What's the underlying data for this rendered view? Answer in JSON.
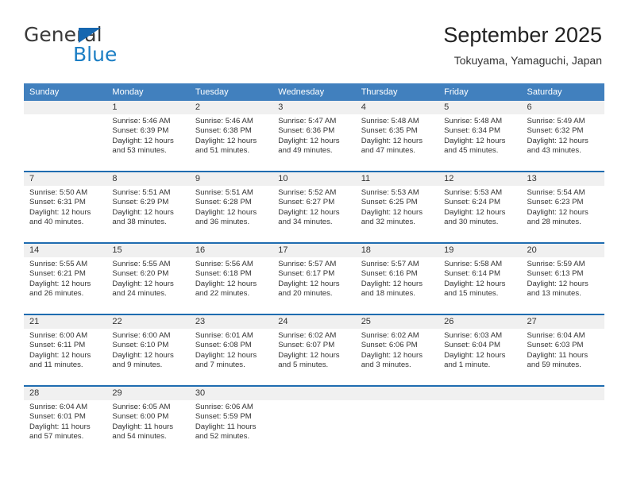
{
  "logo": {
    "word_top": "General",
    "word_bottom": "Blue",
    "triangle_color": "#1667b0",
    "blue_color": "#1b7ec4"
  },
  "header": {
    "title": "September 2025",
    "subtitle": "Tokuyama, Yamaguchi, Japan"
  },
  "theme": {
    "header_bar": "#4180be",
    "row_separator": "#1f6cb0",
    "day_band": "#f0f0f0"
  },
  "weekdays": [
    "Sunday",
    "Monday",
    "Tuesday",
    "Wednesday",
    "Thursday",
    "Friday",
    "Saturday"
  ],
  "weeks": [
    [
      {
        "day": "",
        "sunrise": "",
        "sunset": "",
        "daylight1": "",
        "daylight2": "",
        "empty": true
      },
      {
        "day": "1",
        "sunrise": "Sunrise: 5:46 AM",
        "sunset": "Sunset: 6:39 PM",
        "daylight1": "Daylight: 12 hours",
        "daylight2": "and 53 minutes."
      },
      {
        "day": "2",
        "sunrise": "Sunrise: 5:46 AM",
        "sunset": "Sunset: 6:38 PM",
        "daylight1": "Daylight: 12 hours",
        "daylight2": "and 51 minutes."
      },
      {
        "day": "3",
        "sunrise": "Sunrise: 5:47 AM",
        "sunset": "Sunset: 6:36 PM",
        "daylight1": "Daylight: 12 hours",
        "daylight2": "and 49 minutes."
      },
      {
        "day": "4",
        "sunrise": "Sunrise: 5:48 AM",
        "sunset": "Sunset: 6:35 PM",
        "daylight1": "Daylight: 12 hours",
        "daylight2": "and 47 minutes."
      },
      {
        "day": "5",
        "sunrise": "Sunrise: 5:48 AM",
        "sunset": "Sunset: 6:34 PM",
        "daylight1": "Daylight: 12 hours",
        "daylight2": "and 45 minutes."
      },
      {
        "day": "6",
        "sunrise": "Sunrise: 5:49 AM",
        "sunset": "Sunset: 6:32 PM",
        "daylight1": "Daylight: 12 hours",
        "daylight2": "and 43 minutes."
      }
    ],
    [
      {
        "day": "7",
        "sunrise": "Sunrise: 5:50 AM",
        "sunset": "Sunset: 6:31 PM",
        "daylight1": "Daylight: 12 hours",
        "daylight2": "and 40 minutes."
      },
      {
        "day": "8",
        "sunrise": "Sunrise: 5:51 AM",
        "sunset": "Sunset: 6:29 PM",
        "daylight1": "Daylight: 12 hours",
        "daylight2": "and 38 minutes."
      },
      {
        "day": "9",
        "sunrise": "Sunrise: 5:51 AM",
        "sunset": "Sunset: 6:28 PM",
        "daylight1": "Daylight: 12 hours",
        "daylight2": "and 36 minutes."
      },
      {
        "day": "10",
        "sunrise": "Sunrise: 5:52 AM",
        "sunset": "Sunset: 6:27 PM",
        "daylight1": "Daylight: 12 hours",
        "daylight2": "and 34 minutes."
      },
      {
        "day": "11",
        "sunrise": "Sunrise: 5:53 AM",
        "sunset": "Sunset: 6:25 PM",
        "daylight1": "Daylight: 12 hours",
        "daylight2": "and 32 minutes."
      },
      {
        "day": "12",
        "sunrise": "Sunrise: 5:53 AM",
        "sunset": "Sunset: 6:24 PM",
        "daylight1": "Daylight: 12 hours",
        "daylight2": "and 30 minutes."
      },
      {
        "day": "13",
        "sunrise": "Sunrise: 5:54 AM",
        "sunset": "Sunset: 6:23 PM",
        "daylight1": "Daylight: 12 hours",
        "daylight2": "and 28 minutes."
      }
    ],
    [
      {
        "day": "14",
        "sunrise": "Sunrise: 5:55 AM",
        "sunset": "Sunset: 6:21 PM",
        "daylight1": "Daylight: 12 hours",
        "daylight2": "and 26 minutes."
      },
      {
        "day": "15",
        "sunrise": "Sunrise: 5:55 AM",
        "sunset": "Sunset: 6:20 PM",
        "daylight1": "Daylight: 12 hours",
        "daylight2": "and 24 minutes."
      },
      {
        "day": "16",
        "sunrise": "Sunrise: 5:56 AM",
        "sunset": "Sunset: 6:18 PM",
        "daylight1": "Daylight: 12 hours",
        "daylight2": "and 22 minutes."
      },
      {
        "day": "17",
        "sunrise": "Sunrise: 5:57 AM",
        "sunset": "Sunset: 6:17 PM",
        "daylight1": "Daylight: 12 hours",
        "daylight2": "and 20 minutes."
      },
      {
        "day": "18",
        "sunrise": "Sunrise: 5:57 AM",
        "sunset": "Sunset: 6:16 PM",
        "daylight1": "Daylight: 12 hours",
        "daylight2": "and 18 minutes."
      },
      {
        "day": "19",
        "sunrise": "Sunrise: 5:58 AM",
        "sunset": "Sunset: 6:14 PM",
        "daylight1": "Daylight: 12 hours",
        "daylight2": "and 15 minutes."
      },
      {
        "day": "20",
        "sunrise": "Sunrise: 5:59 AM",
        "sunset": "Sunset: 6:13 PM",
        "daylight1": "Daylight: 12 hours",
        "daylight2": "and 13 minutes."
      }
    ],
    [
      {
        "day": "21",
        "sunrise": "Sunrise: 6:00 AM",
        "sunset": "Sunset: 6:11 PM",
        "daylight1": "Daylight: 12 hours",
        "daylight2": "and 11 minutes."
      },
      {
        "day": "22",
        "sunrise": "Sunrise: 6:00 AM",
        "sunset": "Sunset: 6:10 PM",
        "daylight1": "Daylight: 12 hours",
        "daylight2": "and 9 minutes."
      },
      {
        "day": "23",
        "sunrise": "Sunrise: 6:01 AM",
        "sunset": "Sunset: 6:08 PM",
        "daylight1": "Daylight: 12 hours",
        "daylight2": "and 7 minutes."
      },
      {
        "day": "24",
        "sunrise": "Sunrise: 6:02 AM",
        "sunset": "Sunset: 6:07 PM",
        "daylight1": "Daylight: 12 hours",
        "daylight2": "and 5 minutes."
      },
      {
        "day": "25",
        "sunrise": "Sunrise: 6:02 AM",
        "sunset": "Sunset: 6:06 PM",
        "daylight1": "Daylight: 12 hours",
        "daylight2": "and 3 minutes."
      },
      {
        "day": "26",
        "sunrise": "Sunrise: 6:03 AM",
        "sunset": "Sunset: 6:04 PM",
        "daylight1": "Daylight: 12 hours",
        "daylight2": "and 1 minute."
      },
      {
        "day": "27",
        "sunrise": "Sunrise: 6:04 AM",
        "sunset": "Sunset: 6:03 PM",
        "daylight1": "Daylight: 11 hours",
        "daylight2": "and 59 minutes."
      }
    ],
    [
      {
        "day": "28",
        "sunrise": "Sunrise: 6:04 AM",
        "sunset": "Sunset: 6:01 PM",
        "daylight1": "Daylight: 11 hours",
        "daylight2": "and 57 minutes."
      },
      {
        "day": "29",
        "sunrise": "Sunrise: 6:05 AM",
        "sunset": "Sunset: 6:00 PM",
        "daylight1": "Daylight: 11 hours",
        "daylight2": "and 54 minutes."
      },
      {
        "day": "30",
        "sunrise": "Sunrise: 6:06 AM",
        "sunset": "Sunset: 5:59 PM",
        "daylight1": "Daylight: 11 hours",
        "daylight2": "and 52 minutes."
      },
      {
        "day": "",
        "sunrise": "",
        "sunset": "",
        "daylight1": "",
        "daylight2": "",
        "empty": true
      },
      {
        "day": "",
        "sunrise": "",
        "sunset": "",
        "daylight1": "",
        "daylight2": "",
        "empty": true
      },
      {
        "day": "",
        "sunrise": "",
        "sunset": "",
        "daylight1": "",
        "daylight2": "",
        "empty": true
      },
      {
        "day": "",
        "sunrise": "",
        "sunset": "",
        "daylight1": "",
        "daylight2": "",
        "empty": true
      }
    ]
  ]
}
